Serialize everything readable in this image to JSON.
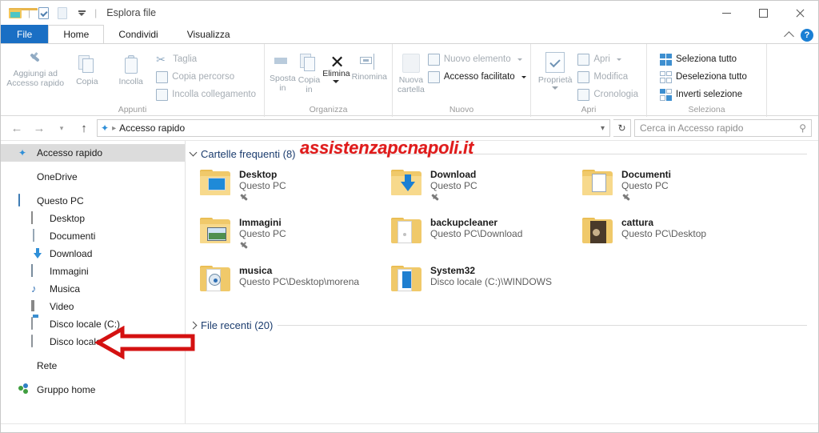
{
  "window": {
    "title": "Esplora file",
    "quick_access_toolbar": [
      "folder-icon",
      "properties-icon",
      "new-folder-icon",
      "customize-caret"
    ],
    "controls": {
      "minimize": "minimize-icon",
      "maximize": "maximize-icon",
      "close": "close-icon"
    }
  },
  "tabs": [
    {
      "id": "file",
      "label": "File"
    },
    {
      "id": "home",
      "label": "Home"
    },
    {
      "id": "condividi",
      "label": "Condividi"
    },
    {
      "id": "visualizza",
      "label": "Visualizza"
    }
  ],
  "tab_right": {
    "collapse": "chevron-up-icon",
    "help": "?"
  },
  "ribbon": {
    "groups": [
      {
        "name": "Appunti",
        "label": "Appunti",
        "big": [
          {
            "label": "Aggiungi ad\nAccesso rapido",
            "line1": "Aggiungi ad",
            "line2": "Accesso rapido",
            "icon": "pin-icon"
          },
          {
            "label": "Copia",
            "icon": "copy-icon"
          },
          {
            "label": "Incolla",
            "icon": "paste-icon"
          }
        ],
        "small": [
          {
            "label": "Taglia",
            "icon": "scissors-icon"
          },
          {
            "label": "Copia percorso",
            "icon": "copy-path-icon"
          },
          {
            "label": "Incolla collegamento",
            "icon": "paste-shortcut-icon"
          }
        ]
      },
      {
        "name": "Organizza",
        "label": "Organizza",
        "big": [
          {
            "line1": "Sposta",
            "line2": "in",
            "icon": "move-to-icon",
            "caret": true
          },
          {
            "line1": "Copia",
            "line2": "in",
            "icon": "copy-to-icon",
            "caret": true
          },
          {
            "label": "Elimina",
            "icon": "delete-icon",
            "caret": true
          },
          {
            "label": "Rinomina",
            "icon": "rename-icon"
          }
        ]
      },
      {
        "name": "Nuovo",
        "label": "Nuovo",
        "big": [
          {
            "line1": "Nuova",
            "line2": "cartella",
            "icon": "new-folder-icon"
          }
        ],
        "small": [
          {
            "label": "Nuovo elemento",
            "icon": "new-item-icon",
            "caret": true
          },
          {
            "label": "Accesso facilitato",
            "icon": "easy-access-icon",
            "caret": true
          }
        ]
      },
      {
        "name": "Apri",
        "label": "Apri",
        "big": [
          {
            "label": "Proprietà",
            "icon": "properties-icon",
            "caret": true
          }
        ],
        "small": [
          {
            "label": "Apri",
            "icon": "open-icon",
            "caret": true
          },
          {
            "label": "Modifica",
            "icon": "edit-icon"
          },
          {
            "label": "Cronologia",
            "icon": "history-icon"
          }
        ]
      },
      {
        "name": "Seleziona",
        "label": "Seleziona",
        "small": [
          {
            "label": "Seleziona tutto",
            "icon": "select-all-icon"
          },
          {
            "label": "Deseleziona tutto",
            "icon": "deselect-all-icon"
          },
          {
            "label": "Inverti selezione",
            "icon": "invert-selection-icon"
          }
        ]
      }
    ]
  },
  "address_bar": {
    "back": "back-arrow-icon",
    "forward": "forward-arrow-icon",
    "recent": "recent-locations-caret",
    "up": "up-arrow-icon",
    "crumb_icon": "quick-access-star-icon",
    "crumb": "Accesso rapido",
    "dropdown": "chevron-down-icon",
    "refresh": "refresh-icon"
  },
  "search": {
    "placeholder": "Cerca in Accesso rapido",
    "icon": "search-icon"
  },
  "sidebar": {
    "items": [
      {
        "label": "Accesso rapido",
        "icon": "star-icon",
        "indent": false,
        "selected": true
      },
      {
        "label": "OneDrive",
        "icon": "onedrive-cloud-icon",
        "indent": false,
        "selected": false,
        "gap_before": true
      },
      {
        "label": "Questo PC",
        "icon": "this-pc-icon",
        "indent": false,
        "selected": false,
        "gap_before": true
      },
      {
        "label": "Desktop",
        "icon": "desktop-icon",
        "indent": true,
        "selected": false
      },
      {
        "label": "Documenti",
        "icon": "documents-icon",
        "indent": true,
        "selected": false
      },
      {
        "label": "Download",
        "icon": "download-icon",
        "indent": true,
        "selected": false
      },
      {
        "label": "Immagini",
        "icon": "pictures-icon",
        "indent": true,
        "selected": false
      },
      {
        "label": "Musica",
        "icon": "music-icon",
        "indent": true,
        "selected": false
      },
      {
        "label": "Video",
        "icon": "video-icon",
        "indent": true,
        "selected": false
      },
      {
        "label": "Disco locale (C:)",
        "icon": "system-drive-icon",
        "indent": true,
        "selected": false
      },
      {
        "label": "Disco locale (I:)",
        "icon": "drive-icon",
        "indent": true,
        "selected": false
      },
      {
        "label": "Rete",
        "icon": "network-icon",
        "indent": false,
        "selected": false,
        "gap_before": true
      },
      {
        "label": "Gruppo home",
        "icon": "homegroup-icon",
        "indent": false,
        "selected": false,
        "gap_before": true
      }
    ]
  },
  "content": {
    "groups": [
      {
        "title": "Cartelle frequenti (8)",
        "expanded": true
      },
      {
        "title": "File recenti (20)",
        "expanded": false
      }
    ],
    "frequent_folders": [
      {
        "name": "Desktop",
        "path": "Questo PC",
        "pinned": true,
        "icon": "folder-desktop-icon"
      },
      {
        "name": "Download",
        "path": "Questo PC",
        "pinned": true,
        "icon": "folder-download-icon"
      },
      {
        "name": "Documenti",
        "path": "Questo PC",
        "pinned": true,
        "icon": "folder-documents-icon"
      },
      {
        "name": "Immagini",
        "path": "Questo PC",
        "pinned": true,
        "icon": "folder-pictures-icon"
      },
      {
        "name": "backupcleaner",
        "path": "Questo PC\\Download",
        "pinned": false,
        "icon": "folder-open-white-icon"
      },
      {
        "name": "cattura",
        "path": "Questo PC\\Desktop",
        "pinned": false,
        "icon": "folder-dark-icon"
      },
      {
        "name": "musica",
        "path": "Questo PC\\Desktop\\morena",
        "pinned": false,
        "icon": "folder-music-icon"
      },
      {
        "name": "System32",
        "path": "Disco locale (C:)\\WINDOWS",
        "pinned": false,
        "icon": "folder-blue-icon"
      }
    ]
  },
  "watermark": {
    "text": "assistenzapcnapoli.it",
    "color": "#e01b1b"
  },
  "annotation": {
    "type": "red-arrow-left",
    "points_to": "Disco locale (C:)",
    "color": "#d41111"
  }
}
